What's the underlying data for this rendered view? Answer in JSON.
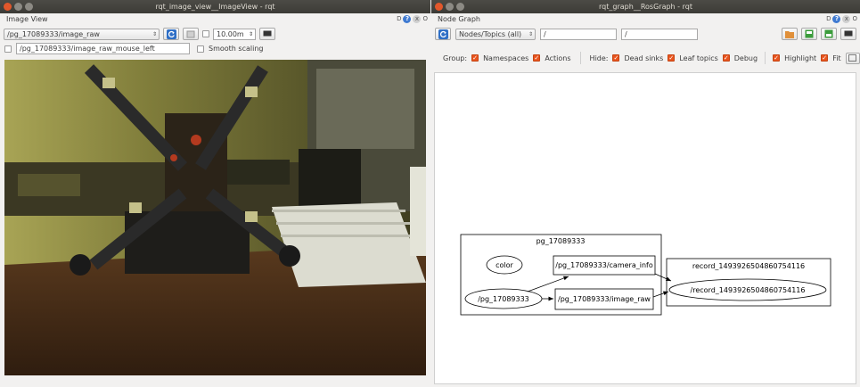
{
  "left_window": {
    "title": "rqt_image_view__ImageView - rqt",
    "dock_title": "Image View",
    "dock_help": "?",
    "dock_close": "x",
    "dock_detach": "O",
    "dock_d": "D",
    "topic_select": "/pg_17089333/image_raw",
    "timeout_value": "10.00m",
    "mouse_topic": "/pg_17089333/image_raw_mouse_left",
    "smooth_scaling_label": "Smooth scaling"
  },
  "right_window": {
    "title": "rqt_graph__RosGraph - rqt",
    "dock_title": "Node Graph",
    "dock_help": "?",
    "dock_close": "x",
    "dock_detach": "O",
    "dock_d": "D",
    "graph_type": "Nodes/Topics (all)",
    "node_filter": "/",
    "topic_filter": "/",
    "group_label": "Group:",
    "namespaces_label": "Namespaces",
    "actions_label": "Actions",
    "hide_label": "Hide:",
    "dead_sinks_label": "Dead sinks",
    "leaf_topics_label": "Leaf topics",
    "debug_label": "Debug",
    "highlight_label": "Highlight",
    "fit_label": "Fit"
  },
  "graph": {
    "cluster1_label": "pg_17089333",
    "node_color": "color",
    "node_pg": "/pg_17089333",
    "topic_camera_info": "/pg_17089333/camera_info",
    "topic_image_raw": "/pg_17089333/image_raw",
    "cluster2_label": "record_1493926504860754116",
    "node_record": "/record_1493926504860754116"
  },
  "colors": {
    "titlebar": "#3c3b37",
    "close_button": "#e2572b",
    "checkbox_accent": "#e9541e"
  }
}
